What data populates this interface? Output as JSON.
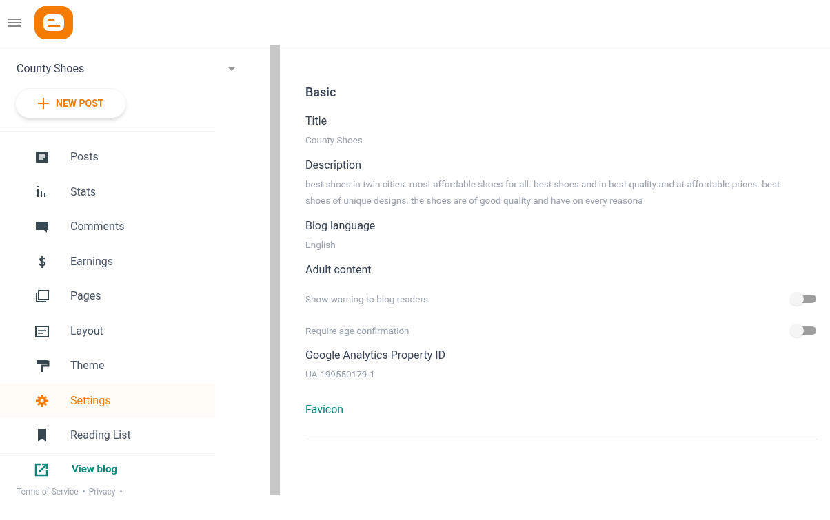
{
  "sidebar": {
    "blog_name": "County Shoes",
    "new_post": "NEW POST",
    "items": [
      {
        "label": "Posts",
        "selected": false
      },
      {
        "label": "Stats",
        "selected": false
      },
      {
        "label": "Comments",
        "selected": false
      },
      {
        "label": "Earnings",
        "selected": false
      },
      {
        "label": "Pages",
        "selected": false
      },
      {
        "label": "Layout",
        "selected": false
      },
      {
        "label": "Theme",
        "selected": false
      },
      {
        "label": "Settings",
        "selected": true
      },
      {
        "label": "Reading List",
        "selected": false
      }
    ],
    "view_blog": "View blog",
    "footer_links": [
      "Terms of Service",
      "Privacy"
    ]
  },
  "settings": {
    "section": "Basic",
    "rows": [
      {
        "kind": "field",
        "label": "Title",
        "value": "County Shoes"
      },
      {
        "kind": "field",
        "label": "Description",
        "value": "best shoes in twin cities. most affordable shoes for all. best shoes and in best quality and at affordable prices. best shoes of unique designs. the shoes are of good quality and have on every reasona"
      },
      {
        "kind": "field",
        "label": "Blog language",
        "value": "English"
      },
      {
        "kind": "heading",
        "label": "Adult content"
      },
      {
        "kind": "toggle",
        "label": "Show warning to blog readers",
        "on": false
      },
      {
        "kind": "toggle",
        "label": "Require age confirmation",
        "on": false
      },
      {
        "kind": "field",
        "label": "Google Analytics Property ID",
        "value": "UA-199550179-1"
      },
      {
        "kind": "link",
        "label": "Favicon"
      }
    ]
  }
}
